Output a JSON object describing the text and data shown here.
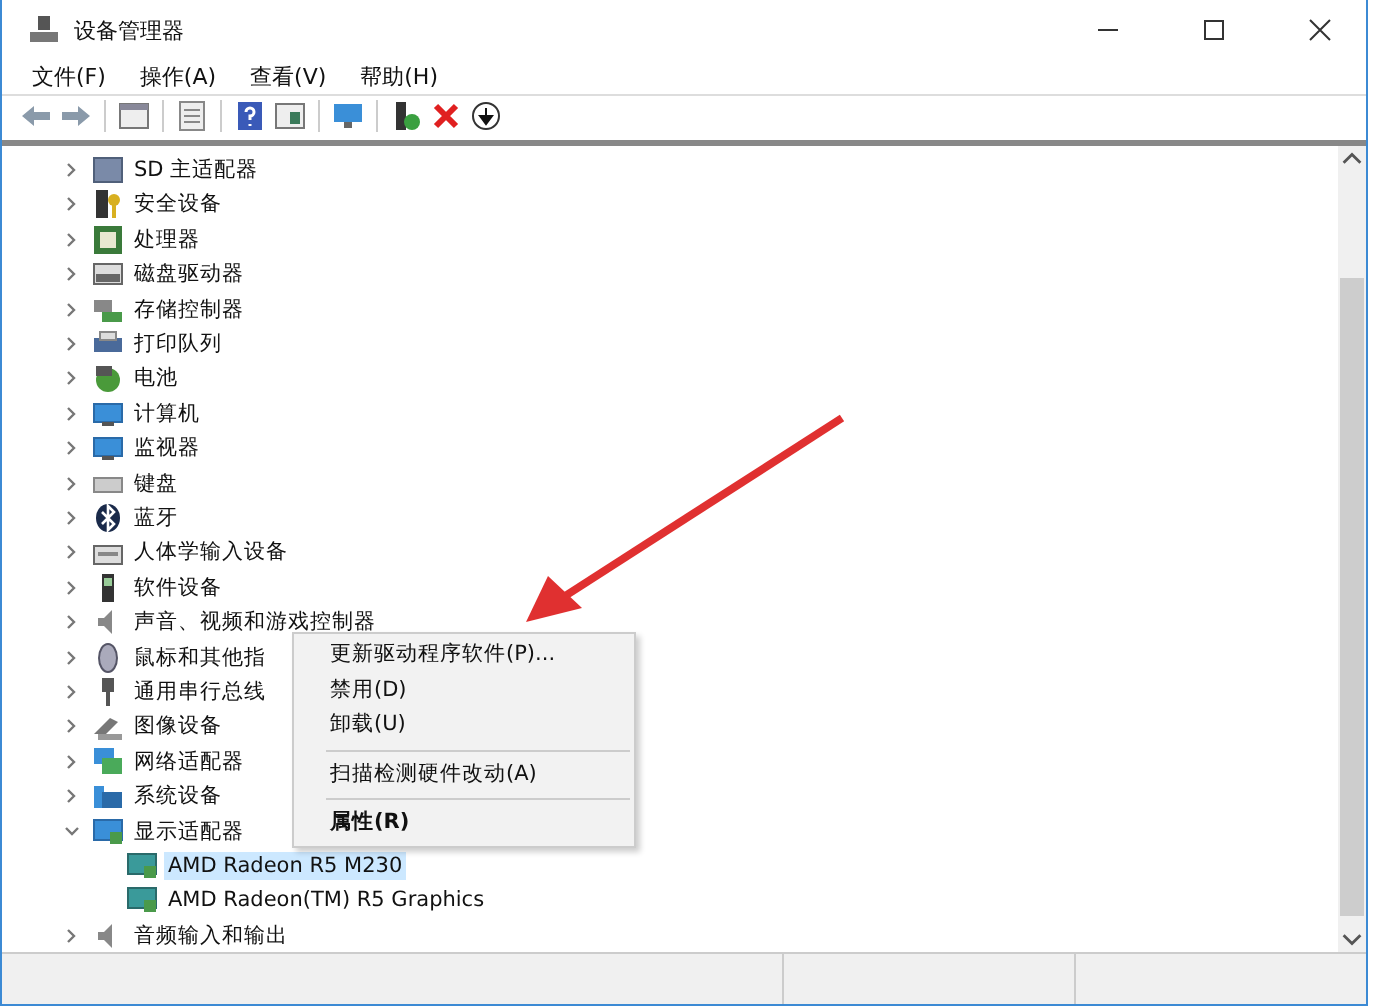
{
  "window": {
    "title": "设备管理器"
  },
  "menu": [
    "文件(F)",
    "操作(A)",
    "查看(V)",
    "帮助(H)"
  ],
  "tree": [
    {
      "label": "SD 主适配器",
      "expanded": false,
      "selected": false
    },
    {
      "label": "安全设备",
      "expanded": false,
      "selected": false
    },
    {
      "label": "处理器",
      "expanded": false,
      "selected": false
    },
    {
      "label": "磁盘驱动器",
      "expanded": false,
      "selected": false
    },
    {
      "label": "存储控制器",
      "expanded": false,
      "selected": false
    },
    {
      "label": "打印队列",
      "expanded": false,
      "selected": false
    },
    {
      "label": "电池",
      "expanded": false,
      "selected": false
    },
    {
      "label": "计算机",
      "expanded": false,
      "selected": false
    },
    {
      "label": "监视器",
      "expanded": false,
      "selected": false
    },
    {
      "label": "键盘",
      "expanded": false,
      "selected": false
    },
    {
      "label": "蓝牙",
      "expanded": false,
      "selected": false
    },
    {
      "label": "人体学输入设备",
      "expanded": false,
      "selected": false
    },
    {
      "label": "软件设备",
      "expanded": false,
      "selected": false
    },
    {
      "label": "声音、视频和游戏控制器",
      "expanded": false,
      "selected": false
    },
    {
      "label": "鼠标和其他指",
      "expanded": false,
      "selected": false
    },
    {
      "label": "通用串行总线",
      "expanded": false,
      "selected": false
    },
    {
      "label": "图像设备",
      "expanded": false,
      "selected": false
    },
    {
      "label": "网络适配器",
      "expanded": false,
      "selected": false
    },
    {
      "label": "系统设备",
      "expanded": false,
      "selected": false
    },
    {
      "label": "显示适配器",
      "expanded": true,
      "selected": false,
      "children": [
        {
          "label": "AMD Radeon R5 M230",
          "selected": true
        },
        {
          "label": "AMD Radeon(TM) R5 Graphics",
          "selected": false
        }
      ]
    },
    {
      "label": "音频输入和输出",
      "expanded": false,
      "selected": false
    }
  ],
  "context_menu": [
    {
      "kind": "item",
      "label": "更新驱动程序软件(P)...",
      "bold": false
    },
    {
      "kind": "item",
      "label": "禁用(D)",
      "bold": false
    },
    {
      "kind": "item",
      "label": "卸载(U)",
      "bold": false
    },
    {
      "kind": "separator"
    },
    {
      "kind": "item",
      "label": "扫描检测硬件改动(A)",
      "bold": false
    },
    {
      "kind": "separator"
    },
    {
      "kind": "item",
      "label": "属性(R)",
      "bold": true
    }
  ]
}
